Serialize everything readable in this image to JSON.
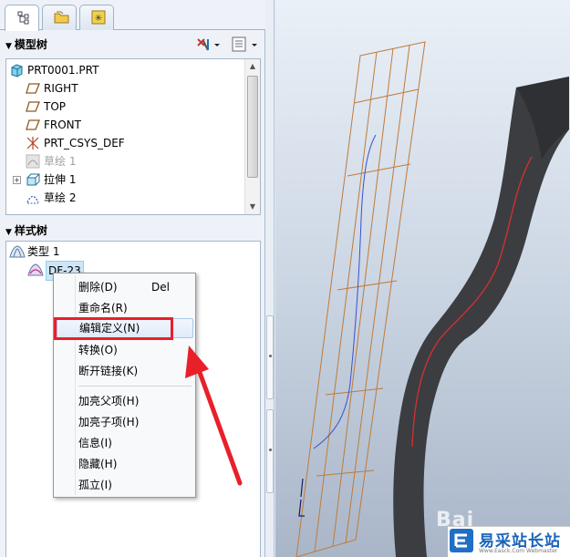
{
  "model_tree": {
    "title": "模型树",
    "items": [
      {
        "label": "PRT0001.PRT",
        "icon": "part-icon"
      },
      {
        "label": "RIGHT",
        "icon": "datum-plane-icon"
      },
      {
        "label": "TOP",
        "icon": "datum-plane-icon"
      },
      {
        "label": "FRONT",
        "icon": "datum-plane-icon"
      },
      {
        "label": "PRT_CSYS_DEF",
        "icon": "coordinate-system-icon"
      },
      {
        "label": "草绘 1",
        "icon": "sketch-icon"
      },
      {
        "label": "拉伸 1",
        "icon": "extrude-icon"
      },
      {
        "label": "草绘 2",
        "icon": "sketch-icon"
      }
    ]
  },
  "style_tree": {
    "title": "样式树",
    "items": [
      {
        "label": "类型 1",
        "icon": "style-type-icon"
      },
      {
        "label": "DF-23",
        "icon": "style-feature-icon"
      }
    ]
  },
  "context_menu": {
    "items": [
      {
        "label": "删除(D)",
        "shortcut": "Del"
      },
      {
        "label": "重命名(R)"
      },
      {
        "label": "编辑定义(N)"
      },
      {
        "label": "转换(O)"
      },
      {
        "label": "断开链接(K)"
      },
      {
        "label": "加亮父项(H)"
      },
      {
        "label": "加亮子项(H)"
      },
      {
        "label": "信息(I)"
      },
      {
        "label": "隐藏(H)"
      },
      {
        "label": "孤立(I)"
      }
    ]
  },
  "watermark": {
    "title": "易采站长站",
    "subtitle": "Www.Easck.Com Webmaster",
    "baidu": "Bai"
  },
  "colors": {
    "highlight": "#e8202a",
    "arrow": "#e8202a",
    "surface": "#3a3c40",
    "wireframe": "#c07a3a",
    "curve_blue": "#3a4fd0",
    "curve_red": "#d03030"
  }
}
